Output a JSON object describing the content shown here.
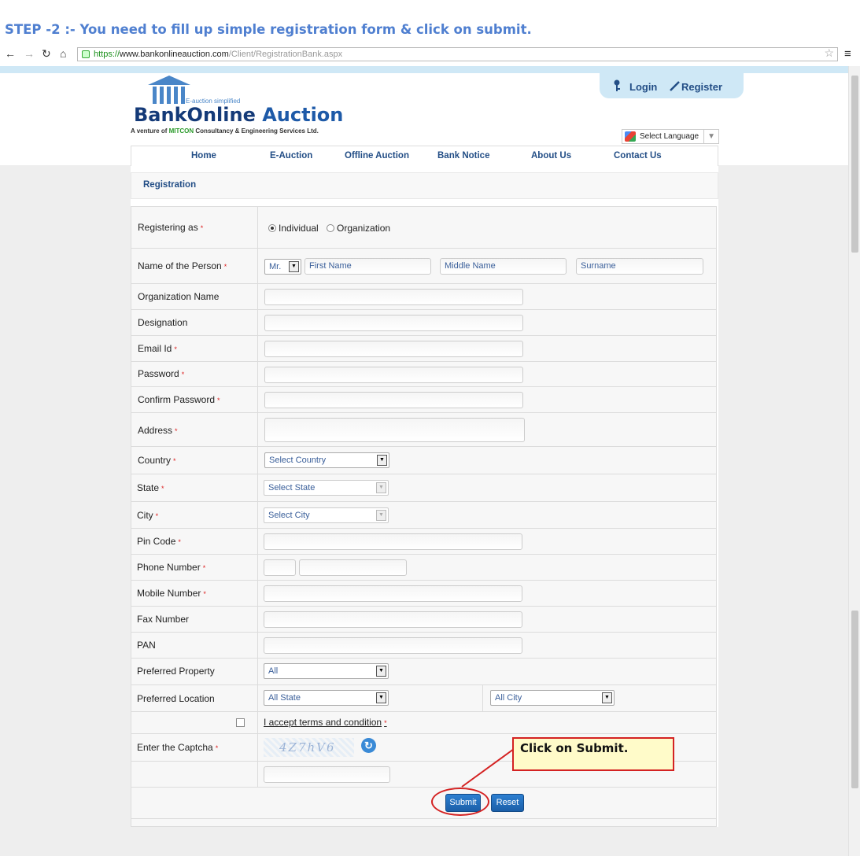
{
  "instruction": "STEP -2 :- You need to fill up simple registration form & click on submit.",
  "browser": {
    "url_scheme": "https://",
    "url_host": "www.bankonlineauction.com",
    "url_path": "/Client/RegistrationBank.aspx"
  },
  "logo": {
    "tagline": "E-auction simplified",
    "name_part1": "BankOnline ",
    "name_part2": "Auction",
    "venture_prefix": "A venture of ",
    "venture_mitcon": "MITCON",
    "venture_suffix": " Consultancy & Engineering Services Ltd."
  },
  "header": {
    "login": "Login",
    "register": "Register",
    "language": "Select Language"
  },
  "nav": [
    "Home",
    "E-Auction",
    "Offline Auction",
    "Bank Notice",
    "About Us",
    "Contact Us"
  ],
  "form": {
    "title": "Registration",
    "required_mark": "*",
    "registering_as": {
      "label": "Registering as",
      "options": [
        "Individual",
        "Organization"
      ],
      "selected": "Individual"
    },
    "name_person": {
      "label": "Name of the Person",
      "title_value": "Mr.",
      "first": "First Name",
      "middle": "Middle Name",
      "surname": "Surname"
    },
    "organization_name": "Organization Name",
    "designation": "Designation",
    "email": "Email Id",
    "password": "Password",
    "confirm_password": "Confirm Password",
    "address": "Address",
    "country": {
      "label": "Country",
      "value": "Select Country"
    },
    "state": {
      "label": "State",
      "value": "Select State"
    },
    "city": {
      "label": "City",
      "value": "Select City"
    },
    "pin_code": "Pin Code",
    "phone": "Phone Number",
    "mobile": "Mobile Number",
    "fax": "Fax Number",
    "pan": "PAN",
    "preferred_property": {
      "label": "Preferred Property",
      "value": "All"
    },
    "preferred_location": {
      "label": "Preferred Location",
      "state": "All State",
      "city": "All City"
    },
    "terms": "I accept terms and condition",
    "captcha": {
      "label": "Enter the Captcha",
      "text": "4Z7hV6"
    },
    "submit": "Submit",
    "reset": "Reset"
  },
  "annotation": "Click on Submit.",
  "colors": {
    "accent": "#234e86",
    "heading": "#4f7fd0",
    "callout_border": "#d42222",
    "callout_bg": "#fffbc9"
  }
}
